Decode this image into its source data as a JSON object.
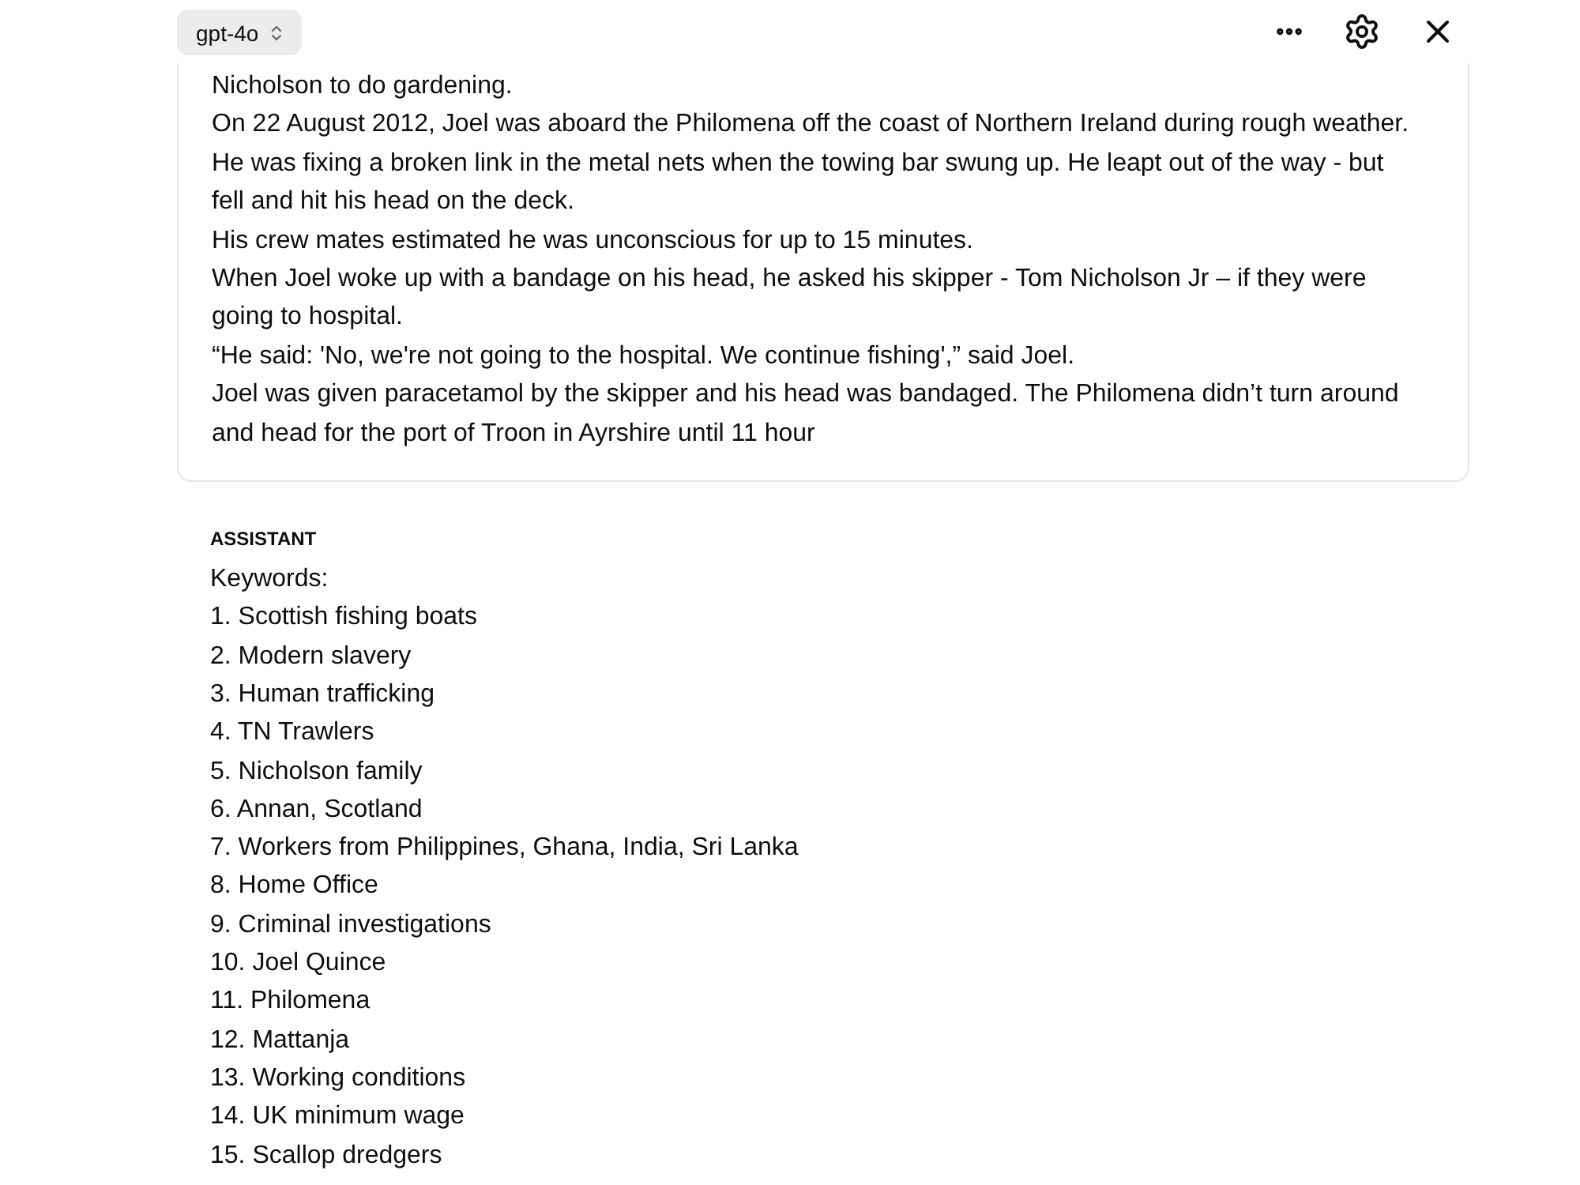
{
  "header": {
    "model_selector": {
      "label": "gpt-4o"
    }
  },
  "user_message": {
    "paragraphs": [
      "Nicholson to do gardening.",
      "On 22 August 2012, Joel was aboard the Philomena off the coast of Northern Ireland during rough weather.",
      "He was fixing a broken link in the metal nets when the towing bar swung up. He leapt out of the way - but fell and hit his head on the deck.",
      "His crew mates estimated he was unconscious for up to 15 minutes.",
      "When Joel woke up with a bandage on his head, he asked his skipper - Tom Nicholson Jr – if they were going to hospital.",
      "“He said: 'No, we're not going to the hospital. We continue fishing',” said Joel.",
      "Joel was given paracetamol by the skipper and his head was bandaged. The Philomena didn’t turn around and head for the port of Troon in Ayrshire until 11 hour"
    ]
  },
  "assistant_message": {
    "role_label": "ASSISTANT",
    "intro": "Keywords:",
    "keywords": [
      "1. Scottish fishing boats",
      "2. Modern slavery",
      "3. Human trafficking",
      "4. TN Trawlers",
      "5. Nicholson family",
      "6. Annan, Scotland",
      "7. Workers from Philippines, Ghana, India, Sri Lanka",
      "8. Home Office",
      "9. Criminal investigations",
      "10. Joel Quince",
      "11. Philomena",
      "12. Mattanja",
      "13. Working conditions",
      "14. UK minimum wage",
      "15. Scallop dredgers"
    ]
  }
}
